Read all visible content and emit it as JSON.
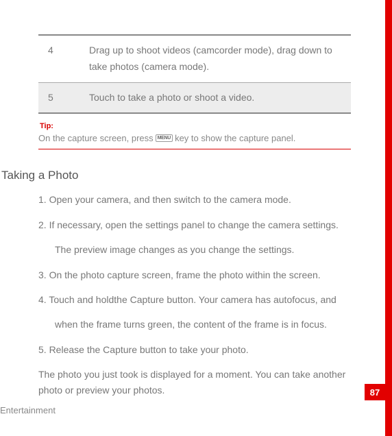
{
  "table": {
    "rows": [
      {
        "num": "4",
        "text": "Drag up to shoot videos (camcorder mode), drag down to take photos (camera mode)."
      },
      {
        "num": "5",
        "text": "Touch to take a photo or shoot a video."
      }
    ]
  },
  "tip": {
    "label": "Tip:",
    "before": "On the capture screen, press",
    "key": "MENU",
    "after": "key to show the capture panel."
  },
  "section": {
    "heading": "Taking a Photo",
    "steps": [
      "1. Open your camera, and then switch to the camera mode.",
      "2. If necessary, open the settings panel to change the camera settings.",
      "The preview image changes as you change the settings.",
      "3. On the photo capture screen, frame the photo within the screen.",
      "4. Touch and holdthe Capture button. Your camera has autofocus, and",
      "when the frame turns green, the content of the frame is in focus.",
      "5. Release the Capture button to take your photo."
    ],
    "note": "The photo you just took is displayed for a moment. You can take another photo or preview your photos."
  },
  "footer": "Entertainment",
  "pageNumber": "87"
}
